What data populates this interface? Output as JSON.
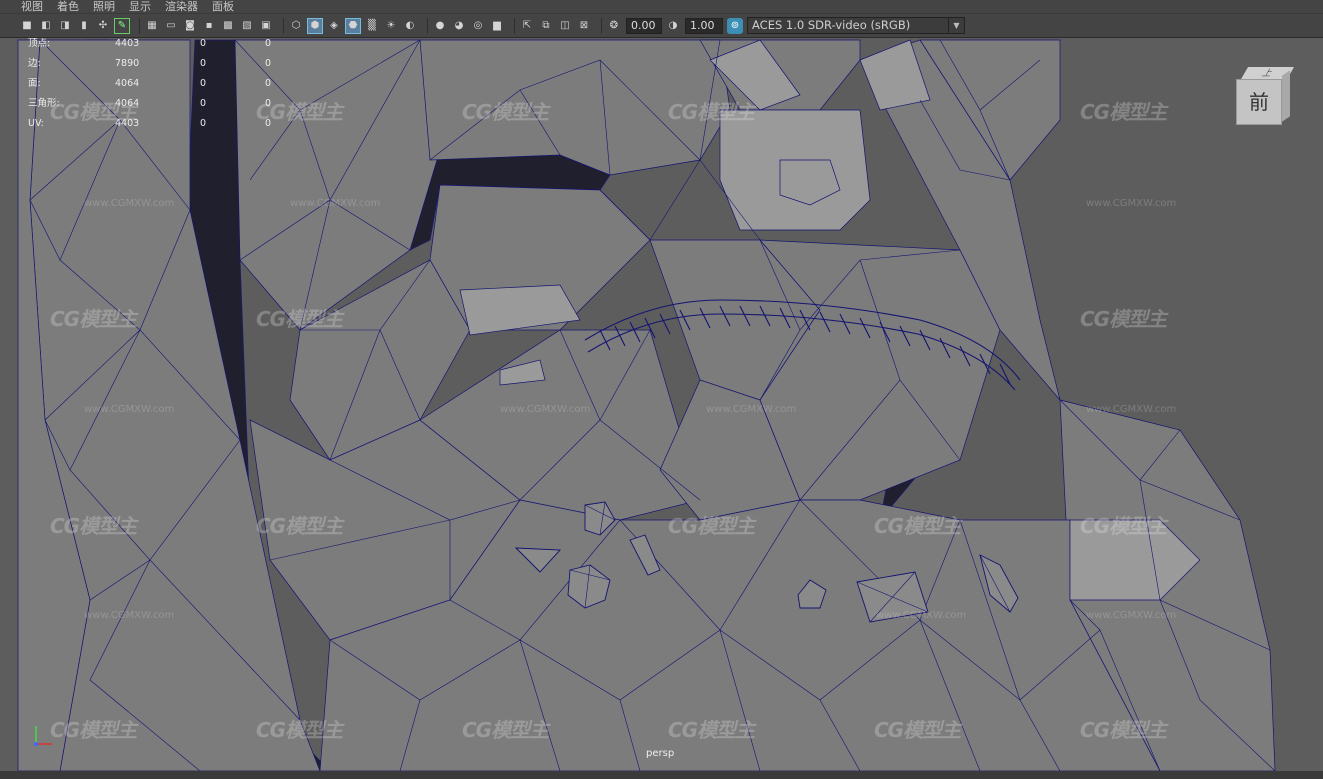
{
  "menu": {
    "items": [
      "视图",
      "着色",
      "照明",
      "显示",
      "渲染器",
      "面板"
    ]
  },
  "toolbar": {
    "gamma_value": "0.00",
    "exposure_value": "1.00",
    "colorspace_label": "ACES 1.0 SDR-video (sRGB)",
    "icons": [
      "camera-select-icon",
      "camera-lock-icon",
      "camera-attributes-icon",
      "bookmark-icon",
      "image-plane-icon",
      "grease-pencil-icon",
      "grid-icon",
      "film-gate-icon",
      "resolution-gate-icon",
      "gate-mask-icon",
      "field-chart-icon",
      "safe-action-icon",
      "safe-title-icon",
      "wireframe-icon",
      "smooth-shade-icon",
      "wireframe-on-shaded-icon",
      "textured-icon",
      "use-lights-icon",
      "shadows-icon",
      "screen-space-ao-icon",
      "motion-blur-icon",
      "anti-aliasing-icon",
      "depth-of-field-icon",
      "isolate-select-icon",
      "xray-icon",
      "xray-joints-icon",
      "xray-components-icon",
      "exposure-icon",
      "gamma-icon",
      "color-management-icon"
    ]
  },
  "hud": {
    "rows": [
      {
        "label": "顶点:",
        "v1": "4403",
        "v2": "0",
        "v3": "0"
      },
      {
        "label": "边:",
        "v1": "7890",
        "v2": "0",
        "v3": "0"
      },
      {
        "label": "面:",
        "v1": "4064",
        "v2": "0",
        "v3": "0"
      },
      {
        "label": "三角形:",
        "v1": "4064",
        "v2": "0",
        "v3": "0"
      },
      {
        "label": "UV:",
        "v1": "4403",
        "v2": "0",
        "v3": "0"
      }
    ]
  },
  "viewcube": {
    "top_label": "上",
    "front_label": "前"
  },
  "camera_label": "persp",
  "watermark": {
    "logo_text": "CG模型主",
    "url_text": "www.CGMXW.com"
  },
  "colors": {
    "ui_bg": "#444444",
    "viewport_bg": "#5d5d5d",
    "wire": "#1a1a6e",
    "accent": "#3b8fb5"
  }
}
